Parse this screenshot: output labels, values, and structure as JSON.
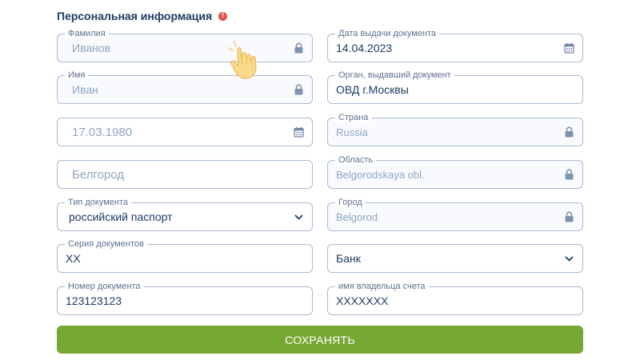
{
  "section": {
    "title": "Персональная информация"
  },
  "left_fields": {
    "last_name": {
      "label": "Фамилия",
      "value": "Иванов"
    },
    "first_name": {
      "label": "Имя",
      "value": "Иван"
    },
    "birth_date": {
      "label": "",
      "value": "17.03.1980"
    },
    "city": {
      "label": "",
      "value": "Белгород"
    },
    "doc_type": {
      "label": "Тип документа",
      "value": "российский паспорт"
    },
    "doc_series": {
      "label": "Серия документов",
      "value": "XX"
    },
    "doc_number": {
      "label": "Номер документа",
      "value": "123123123"
    }
  },
  "right_fields": {
    "issue_date": {
      "label": "Дата выдачи документа",
      "value": "14.04.2023"
    },
    "issuer": {
      "label": "Орган, выдавший документ",
      "value": "ОВД г.Москвы"
    },
    "country": {
      "label": "Страна",
      "value": "Russia"
    },
    "region": {
      "label": "Область",
      "value": "Belgorodskaya obl."
    },
    "town": {
      "label": "Город",
      "value": "Belgorod"
    },
    "bank": {
      "label": "",
      "value": "Банк"
    },
    "account_holder": {
      "label": "имя владельца счета",
      "value": "XXXXXXX"
    }
  },
  "save_label": "СОХРАНЯТЬ",
  "colors": {
    "accent": "#77a833",
    "title": "#1f3b61",
    "border": "#a9bbd3",
    "alert": "#e5534b"
  },
  "icons": [
    "lock-icon",
    "calendar-icon",
    "chevron-down-icon",
    "alert-icon",
    "hand-pointer-icon"
  ]
}
